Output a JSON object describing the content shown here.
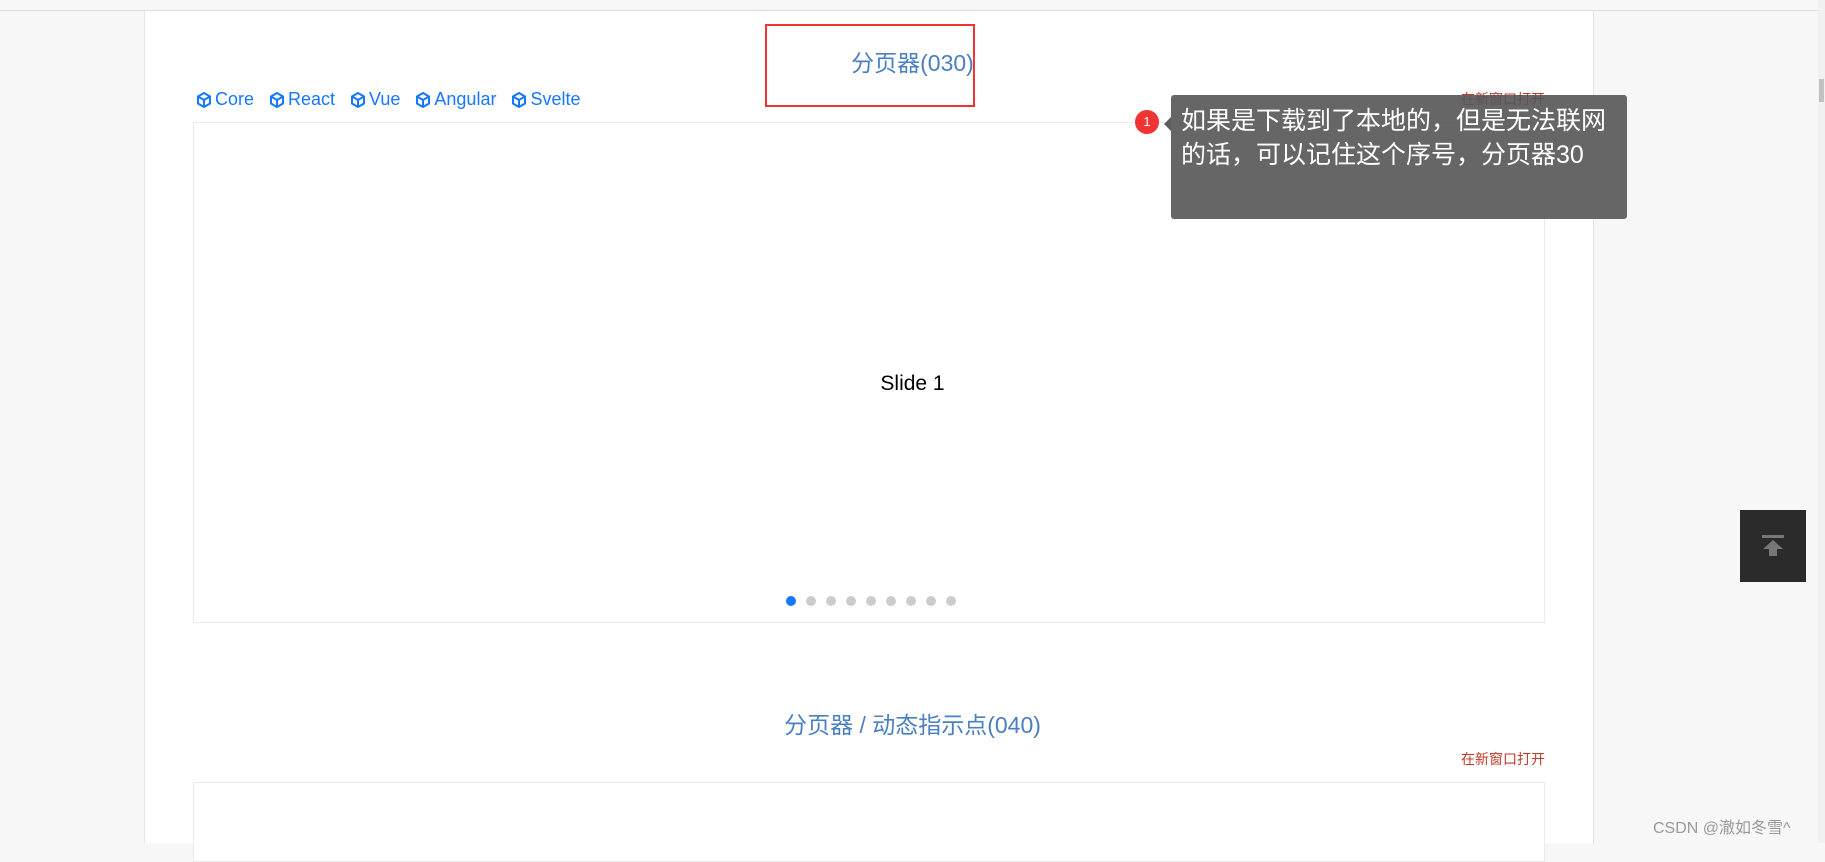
{
  "section1": {
    "title": "分页器(030)",
    "open_link": "在新窗口打开",
    "frameworks": [
      "Core",
      "React",
      "Vue",
      "Angular",
      "Svelte"
    ],
    "slide_text": "Slide 1",
    "pagination": {
      "total": 9,
      "active": 1
    }
  },
  "annotation": {
    "badge": "1",
    "text": "如果是下载到了本地的，但是无法联网的话，可以记住这个序号，分页器30"
  },
  "section2": {
    "title": "分页器 / 动态指示点(040)",
    "open_link": "在新窗口打开"
  },
  "watermark": "CSDN @澈如冬雪^",
  "colors": {
    "link": "#1677ff",
    "title": "#4a7fc1",
    "highlight": "#f03333"
  }
}
